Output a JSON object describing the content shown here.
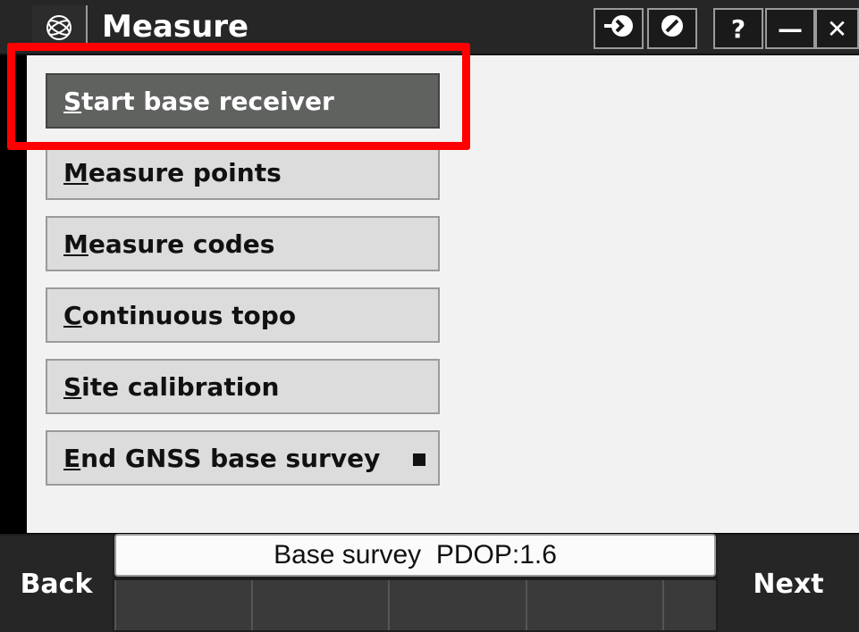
{
  "titlebar": {
    "title": "Measure",
    "app_icon": "trimble-globe-icon",
    "buttons": [
      {
        "icon": "enter-arrow-icon",
        "label": ""
      },
      {
        "icon": "cancel-circle-icon",
        "label": ""
      },
      {
        "icon": "help-icon",
        "label": "?"
      },
      {
        "icon": "minimize-icon",
        "label": "—"
      },
      {
        "icon": "close-icon",
        "label": "✕"
      }
    ]
  },
  "menu": {
    "items": [
      {
        "first": "S",
        "rest": "tart base receiver",
        "selected": true
      },
      {
        "first": "M",
        "rest": "easure points"
      },
      {
        "first": "M",
        "rest": "easure codes"
      },
      {
        "first": "C",
        "rest": "ontinuous topo"
      },
      {
        "first": "S",
        "rest": "ite calibration"
      },
      {
        "first": "E",
        "rest": "nd GNSS base survey",
        "has_indicator": true
      }
    ]
  },
  "status": {
    "text": "Base survey  PDOP:1.6"
  },
  "softkeys": {
    "back": "Back",
    "next": "Next"
  },
  "colors": {
    "highlight": "#ff0000",
    "selected_bg": "#5f625f",
    "button_bg": "#dcdcdc"
  }
}
